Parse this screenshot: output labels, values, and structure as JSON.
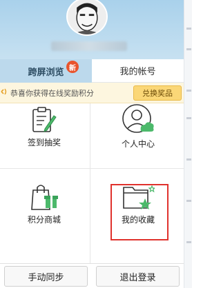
{
  "tabs": [
    {
      "label": "跨屏浏览",
      "badge": "新",
      "active": true
    },
    {
      "label": "我的帐号",
      "active": false
    }
  ],
  "notice": {
    "text": "恭喜你获得在线奖励积分",
    "button_label": "兑换奖品"
  },
  "grid": [
    {
      "label": "签到抽奖",
      "icon": "clipboard-pen-icon"
    },
    {
      "label": "个人中心",
      "icon": "person-cloud-icon"
    },
    {
      "label": "积分商城",
      "icon": "gift-bag-icon"
    },
    {
      "label": "我的收藏",
      "icon": "folder-star-icon",
      "highlighted": true
    }
  ],
  "bottom": {
    "sync_label": "手动同步",
    "logout_label": "退出登录"
  },
  "colors": {
    "header": "#bcd9ec",
    "accent_red": "#e0312c",
    "badge": "#e9542d",
    "notice_bg": "#fdf6df",
    "green": "#4cb96b"
  }
}
